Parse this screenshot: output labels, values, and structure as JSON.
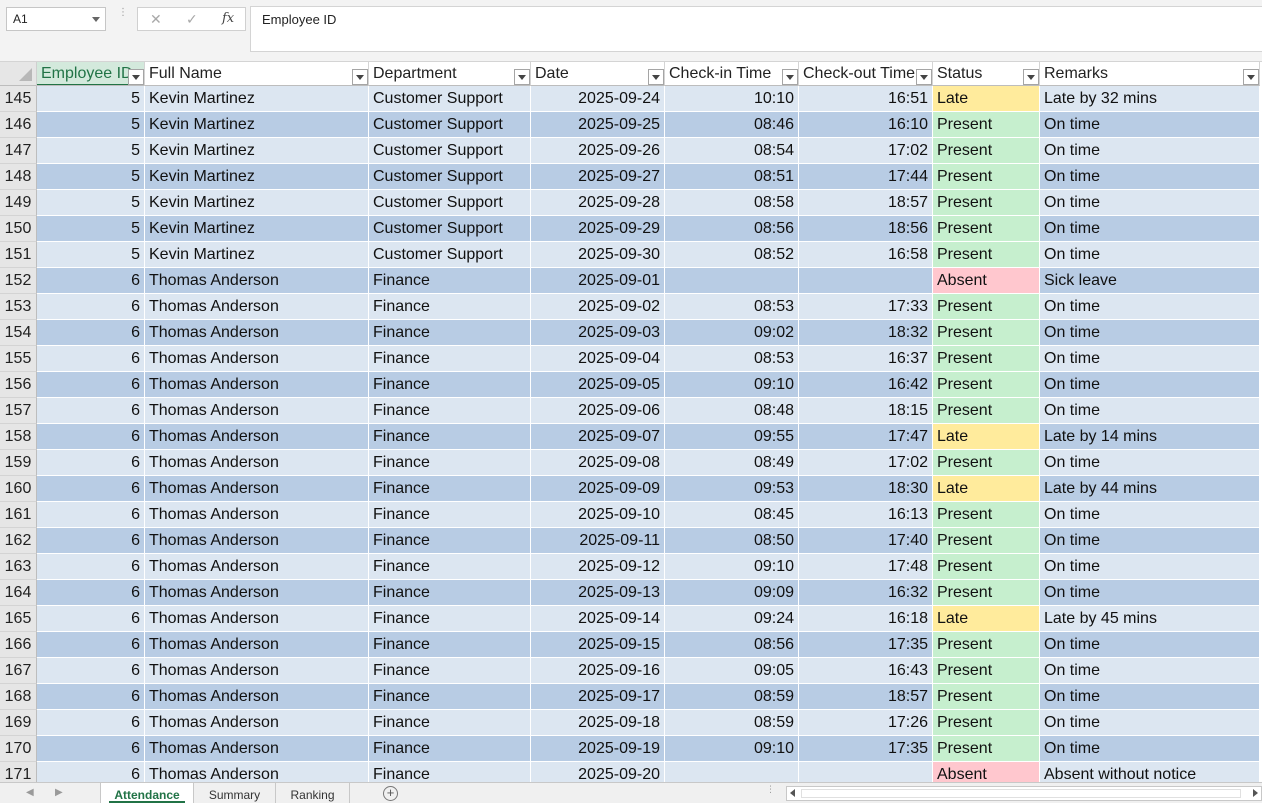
{
  "formula_bar": {
    "name_box": "A1",
    "cancel_icon": "close-icon",
    "enter_icon": "check-icon",
    "fx_label": "fx",
    "formula": "Employee ID"
  },
  "columns": [
    "Employee ID",
    "Full Name",
    "Department",
    "Date",
    "Check-in Time",
    "Check-out Time",
    "Status",
    "Remarks"
  ],
  "status_colors": {
    "Present": "#c6efce",
    "Late": "#ffeb9c",
    "Absent": "#ffc7ce"
  },
  "band_colors": {
    "light": "#dce6f1",
    "dark": "#b8cce4"
  },
  "rows": [
    {
      "num": "145",
      "id": "5",
      "name": "Kevin Martinez",
      "dept": "Customer Support",
      "date": "2025-09-24",
      "in": "10:10",
      "out": "16:51",
      "status": "Late",
      "remarks": "Late by 32 mins"
    },
    {
      "num": "146",
      "id": "5",
      "name": "Kevin Martinez",
      "dept": "Customer Support",
      "date": "2025-09-25",
      "in": "08:46",
      "out": "16:10",
      "status": "Present",
      "remarks": "On time"
    },
    {
      "num": "147",
      "id": "5",
      "name": "Kevin Martinez",
      "dept": "Customer Support",
      "date": "2025-09-26",
      "in": "08:54",
      "out": "17:02",
      "status": "Present",
      "remarks": "On time"
    },
    {
      "num": "148",
      "id": "5",
      "name": "Kevin Martinez",
      "dept": "Customer Support",
      "date": "2025-09-27",
      "in": "08:51",
      "out": "17:44",
      "status": "Present",
      "remarks": "On time"
    },
    {
      "num": "149",
      "id": "5",
      "name": "Kevin Martinez",
      "dept": "Customer Support",
      "date": "2025-09-28",
      "in": "08:58",
      "out": "18:57",
      "status": "Present",
      "remarks": "On time"
    },
    {
      "num": "150",
      "id": "5",
      "name": "Kevin Martinez",
      "dept": "Customer Support",
      "date": "2025-09-29",
      "in": "08:56",
      "out": "18:56",
      "status": "Present",
      "remarks": "On time"
    },
    {
      "num": "151",
      "id": "5",
      "name": "Kevin Martinez",
      "dept": "Customer Support",
      "date": "2025-09-30",
      "in": "08:52",
      "out": "16:58",
      "status": "Present",
      "remarks": "On time"
    },
    {
      "num": "152",
      "id": "6",
      "name": "Thomas Anderson",
      "dept": "Finance",
      "date": "2025-09-01",
      "in": "",
      "out": "",
      "status": "Absent",
      "remarks": "Sick leave"
    },
    {
      "num": "153",
      "id": "6",
      "name": "Thomas Anderson",
      "dept": "Finance",
      "date": "2025-09-02",
      "in": "08:53",
      "out": "17:33",
      "status": "Present",
      "remarks": "On time"
    },
    {
      "num": "154",
      "id": "6",
      "name": "Thomas Anderson",
      "dept": "Finance",
      "date": "2025-09-03",
      "in": "09:02",
      "out": "18:32",
      "status": "Present",
      "remarks": "On time"
    },
    {
      "num": "155",
      "id": "6",
      "name": "Thomas Anderson",
      "dept": "Finance",
      "date": "2025-09-04",
      "in": "08:53",
      "out": "16:37",
      "status": "Present",
      "remarks": "On time"
    },
    {
      "num": "156",
      "id": "6",
      "name": "Thomas Anderson",
      "dept": "Finance",
      "date": "2025-09-05",
      "in": "09:10",
      "out": "16:42",
      "status": "Present",
      "remarks": "On time"
    },
    {
      "num": "157",
      "id": "6",
      "name": "Thomas Anderson",
      "dept": "Finance",
      "date": "2025-09-06",
      "in": "08:48",
      "out": "18:15",
      "status": "Present",
      "remarks": "On time"
    },
    {
      "num": "158",
      "id": "6",
      "name": "Thomas Anderson",
      "dept": "Finance",
      "date": "2025-09-07",
      "in": "09:55",
      "out": "17:47",
      "status": "Late",
      "remarks": "Late by 14 mins"
    },
    {
      "num": "159",
      "id": "6",
      "name": "Thomas Anderson",
      "dept": "Finance",
      "date": "2025-09-08",
      "in": "08:49",
      "out": "17:02",
      "status": "Present",
      "remarks": "On time"
    },
    {
      "num": "160",
      "id": "6",
      "name": "Thomas Anderson",
      "dept": "Finance",
      "date": "2025-09-09",
      "in": "09:53",
      "out": "18:30",
      "status": "Late",
      "remarks": "Late by 44 mins"
    },
    {
      "num": "161",
      "id": "6",
      "name": "Thomas Anderson",
      "dept": "Finance",
      "date": "2025-09-10",
      "in": "08:45",
      "out": "16:13",
      "status": "Present",
      "remarks": "On time"
    },
    {
      "num": "162",
      "id": "6",
      "name": "Thomas Anderson",
      "dept": "Finance",
      "date": "2025-09-11",
      "in": "08:50",
      "out": "17:40",
      "status": "Present",
      "remarks": "On time"
    },
    {
      "num": "163",
      "id": "6",
      "name": "Thomas Anderson",
      "dept": "Finance",
      "date": "2025-09-12",
      "in": "09:10",
      "out": "17:48",
      "status": "Present",
      "remarks": "On time"
    },
    {
      "num": "164",
      "id": "6",
      "name": "Thomas Anderson",
      "dept": "Finance",
      "date": "2025-09-13",
      "in": "09:09",
      "out": "16:32",
      "status": "Present",
      "remarks": "On time"
    },
    {
      "num": "165",
      "id": "6",
      "name": "Thomas Anderson",
      "dept": "Finance",
      "date": "2025-09-14",
      "in": "09:24",
      "out": "16:18",
      "status": "Late",
      "remarks": "Late by 45 mins"
    },
    {
      "num": "166",
      "id": "6",
      "name": "Thomas Anderson",
      "dept": "Finance",
      "date": "2025-09-15",
      "in": "08:56",
      "out": "17:35",
      "status": "Present",
      "remarks": "On time"
    },
    {
      "num": "167",
      "id": "6",
      "name": "Thomas Anderson",
      "dept": "Finance",
      "date": "2025-09-16",
      "in": "09:05",
      "out": "16:43",
      "status": "Present",
      "remarks": "On time"
    },
    {
      "num": "168",
      "id": "6",
      "name": "Thomas Anderson",
      "dept": "Finance",
      "date": "2025-09-17",
      "in": "08:59",
      "out": "18:57",
      "status": "Present",
      "remarks": "On time"
    },
    {
      "num": "169",
      "id": "6",
      "name": "Thomas Anderson",
      "dept": "Finance",
      "date": "2025-09-18",
      "in": "08:59",
      "out": "17:26",
      "status": "Present",
      "remarks": "On time"
    },
    {
      "num": "170",
      "id": "6",
      "name": "Thomas Anderson",
      "dept": "Finance",
      "date": "2025-09-19",
      "in": "09:10",
      "out": "17:35",
      "status": "Present",
      "remarks": "On time"
    },
    {
      "num": "171",
      "id": "6",
      "name": "Thomas Anderson",
      "dept": "Finance",
      "date": "2025-09-20",
      "in": "",
      "out": "",
      "status": "Absent",
      "remarks": "Absent without notice"
    }
  ],
  "sheet_tabs": [
    "Attendance",
    "Summary",
    "Ranking"
  ],
  "active_tab": "Attendance",
  "add_sheet_icon": "plus-circle-icon"
}
